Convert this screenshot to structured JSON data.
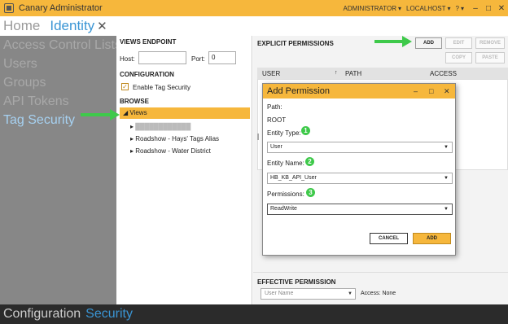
{
  "window": {
    "title": "Canary Administrator",
    "user": "ADMINISTRATOR",
    "host": "LOCALHOST",
    "help": "?"
  },
  "tabs": {
    "home": "Home",
    "active": "Identity",
    "close": "✕"
  },
  "nav": {
    "items": [
      "Access Control Lists",
      "Users",
      "Groups",
      "API Tokens",
      "Tag Security"
    ],
    "active_index": 4
  },
  "bottom": {
    "config": "Configuration",
    "security": "Security"
  },
  "views_endpoint": {
    "section": "VIEWS ENDPOINT",
    "host_label": "Host:",
    "host_value": "",
    "port_label": "Port:",
    "port_value": "0"
  },
  "configuration": {
    "section": "CONFIGURATION",
    "enable_label": "Enable Tag Security",
    "checked": true
  },
  "browse": {
    "section": "BROWSE",
    "root": "Views",
    "items": [
      "████████████",
      "Roadshow - Hays' Tags Alias",
      "Roadshow - Water District"
    ]
  },
  "explicit": {
    "section": "EXPLICIT PERMISSIONS",
    "buttons": {
      "add": "ADD",
      "edit": "EDIT",
      "remove": "REMOVE",
      "copy": "COPY",
      "paste": "PASTE"
    },
    "columns": [
      "USER",
      "PATH",
      "ACCESS"
    ]
  },
  "effective": {
    "section": "EFFECTIVE PERMISSION",
    "placeholder": "User Name",
    "access_label": "Access:",
    "access_value": "None"
  },
  "dialog": {
    "title": "Add Permission",
    "path_label": "Path:",
    "path_value": "ROOT",
    "entity_type_label": "Entity Type:",
    "entity_type_value": "User",
    "entity_name_label": "Entity Name:",
    "entity_name_value": "HB_KB_API_User",
    "permissions_label": "Permissions:",
    "permissions_value": "ReadWrite",
    "cancel": "CANCEL",
    "add": "ADD",
    "badges": [
      "1",
      "2",
      "3"
    ]
  },
  "colors": {
    "accent": "#f6b73c",
    "nav_bg": "#878787",
    "link_blue": "#3a95d4",
    "badge_green": "#3ec94a"
  }
}
